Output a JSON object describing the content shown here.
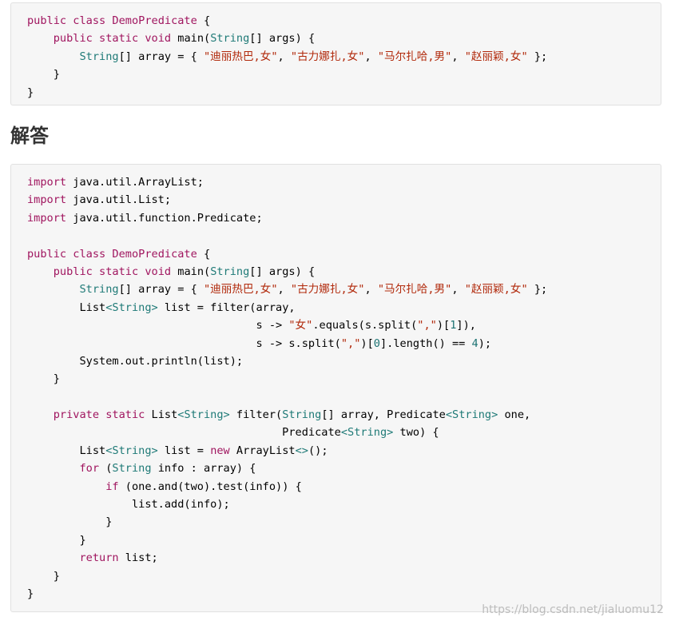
{
  "heading": "解答",
  "watermark": "https://blog.csdn.net/jialuomu12",
  "colors": {
    "keyword": "#a0155f",
    "type": "#1f7a77",
    "string": "#b1290b",
    "number": "#1d7373",
    "plain": "#000000",
    "block_bg": "#f6f6f6"
  },
  "snippet1": {
    "lines": [
      [
        [
          "kw",
          "public class "
        ],
        [
          "cls",
          "DemoPredicate"
        ],
        [
          "p",
          " {"
        ]
      ],
      [
        [
          "p",
          "    "
        ],
        [
          "kw",
          "public static void"
        ],
        [
          "p",
          " main("
        ],
        [
          "typ",
          "String"
        ],
        [
          "p",
          "[] args) {"
        ]
      ],
      [
        [
          "p",
          "        "
        ],
        [
          "typ",
          "String"
        ],
        [
          "p",
          "[] array = { "
        ],
        [
          "str",
          "\"迪丽热巴,女\""
        ],
        [
          "p",
          ", "
        ],
        [
          "str",
          "\"古力娜扎,女\""
        ],
        [
          "p",
          ", "
        ],
        [
          "str",
          "\"马尔扎哈,男\""
        ],
        [
          "p",
          ", "
        ],
        [
          "str",
          "\"赵丽颖,女\""
        ],
        [
          "p",
          " };"
        ]
      ],
      [
        [
          "p",
          "    }"
        ]
      ],
      [
        [
          "p",
          "}"
        ]
      ]
    ]
  },
  "snippet2": {
    "lines": [
      [
        [
          "kw",
          "import"
        ],
        [
          "p",
          " java.util.ArrayList;"
        ]
      ],
      [
        [
          "kw",
          "import"
        ],
        [
          "p",
          " java.util.List;"
        ]
      ],
      [
        [
          "kw",
          "import"
        ],
        [
          "p",
          " java.util.function.Predicate;"
        ]
      ],
      [
        [
          "p",
          ""
        ]
      ],
      [
        [
          "kw",
          "public class "
        ],
        [
          "cls",
          "DemoPredicate"
        ],
        [
          "p",
          " {"
        ]
      ],
      [
        [
          "p",
          "    "
        ],
        [
          "kw",
          "public static void"
        ],
        [
          "p",
          " main("
        ],
        [
          "typ",
          "String"
        ],
        [
          "p",
          "[] args) {"
        ]
      ],
      [
        [
          "p",
          "        "
        ],
        [
          "typ",
          "String"
        ],
        [
          "p",
          "[] array = { "
        ],
        [
          "str",
          "\"迪丽热巴,女\""
        ],
        [
          "p",
          ", "
        ],
        [
          "str",
          "\"古力娜扎,女\""
        ],
        [
          "p",
          ", "
        ],
        [
          "str",
          "\"马尔扎哈,男\""
        ],
        [
          "p",
          ", "
        ],
        [
          "str",
          "\"赵丽颖,女\""
        ],
        [
          "p",
          " };"
        ]
      ],
      [
        [
          "p",
          "        List"
        ],
        [
          "typ",
          "<String>"
        ],
        [
          "p",
          " list = filter(array,"
        ]
      ],
      [
        [
          "p",
          "                                   s -> "
        ],
        [
          "str",
          "\"女\""
        ],
        [
          "p",
          ".equals(s.split("
        ],
        [
          "str",
          "\",\""
        ],
        [
          "p",
          ")["
        ],
        [
          "num",
          "1"
        ],
        [
          "p",
          "]),"
        ]
      ],
      [
        [
          "p",
          "                                   s -> s.split("
        ],
        [
          "str",
          "\",\""
        ],
        [
          "p",
          ")["
        ],
        [
          "num",
          "0"
        ],
        [
          "p",
          "].length() == "
        ],
        [
          "num",
          "4"
        ],
        [
          "p",
          ");"
        ]
      ],
      [
        [
          "p",
          "        System.out.println(list);"
        ]
      ],
      [
        [
          "p",
          "    }"
        ]
      ],
      [
        [
          "p",
          ""
        ]
      ],
      [
        [
          "p",
          "    "
        ],
        [
          "kw",
          "private static"
        ],
        [
          "p",
          " List"
        ],
        [
          "typ",
          "<String>"
        ],
        [
          "p",
          " filter("
        ],
        [
          "typ",
          "String"
        ],
        [
          "p",
          "[] array, Predicate"
        ],
        [
          "typ",
          "<String>"
        ],
        [
          "p",
          " one,"
        ]
      ],
      [
        [
          "p",
          "                                       Predicate"
        ],
        [
          "typ",
          "<String>"
        ],
        [
          "p",
          " two) {"
        ]
      ],
      [
        [
          "p",
          "        List"
        ],
        [
          "typ",
          "<String>"
        ],
        [
          "p",
          " list = "
        ],
        [
          "kw",
          "new"
        ],
        [
          "p",
          " ArrayList"
        ],
        [
          "typ",
          "<>"
        ],
        [
          "p",
          "();"
        ]
      ],
      [
        [
          "p",
          "        "
        ],
        [
          "kw",
          "for"
        ],
        [
          "p",
          " ("
        ],
        [
          "typ",
          "String"
        ],
        [
          "p",
          " info : array) {"
        ]
      ],
      [
        [
          "p",
          "            "
        ],
        [
          "kw",
          "if"
        ],
        [
          "p",
          " (one.and(two).test(info)) {"
        ]
      ],
      [
        [
          "p",
          "                list.add(info);"
        ]
      ],
      [
        [
          "p",
          "            }"
        ]
      ],
      [
        [
          "p",
          "        }"
        ]
      ],
      [
        [
          "p",
          "        "
        ],
        [
          "kw",
          "return"
        ],
        [
          "p",
          " list;"
        ]
      ],
      [
        [
          "p",
          "    }"
        ]
      ],
      [
        [
          "p",
          "}"
        ]
      ]
    ]
  }
}
